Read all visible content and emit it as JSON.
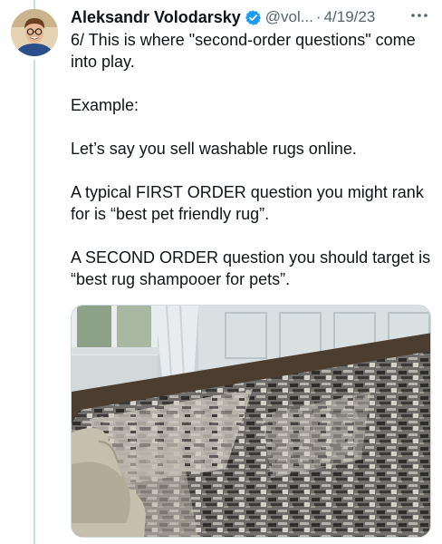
{
  "tweet": {
    "author_name": "Aleksandr Volodarsky",
    "handle": "@vol...",
    "separator": "·",
    "date": "4/19/23",
    "lines": [
      "6/ This is where \"second-order questions\" come into play.",
      "Example:",
      "Let’s say you sell washable rugs online.",
      "A typical FIRST ORDER question you might rank for is “best pet friendly rug”.",
      "A SECOND ORDER question you should target is “best rug shampooer for pets”."
    ]
  },
  "icons": {
    "verified": "verified-badge-icon",
    "more": "more-options-icon"
  },
  "colors": {
    "verified_blue": "#1d9bf0",
    "text": "#0f1419",
    "secondary": "#536471",
    "thread_line": "#cfd9de"
  }
}
